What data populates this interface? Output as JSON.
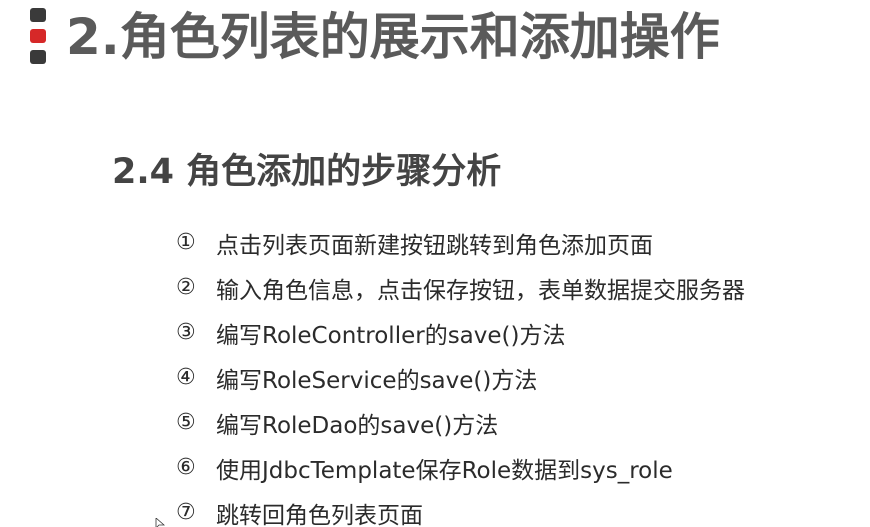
{
  "header": {
    "title": "2.角色列表的展示和添加操作"
  },
  "section": {
    "title": "2.4 角色添加的步骤分析"
  },
  "steps": [
    {
      "num": "①",
      "text": "点击列表页面新建按钮跳转到角色添加页面"
    },
    {
      "num": "②",
      "text": "输入角色信息，点击保存按钮，表单数据提交服务器"
    },
    {
      "num": "③",
      "text": "编写RoleController的save()方法"
    },
    {
      "num": "④",
      "text": "编写RoleService的save()方法"
    },
    {
      "num": "⑤",
      "text": "编写RoleDao的save()方法"
    },
    {
      "num": "⑥",
      "text": "使用JdbcTemplate保存Role数据到sys_role"
    },
    {
      "num": "⑦",
      "text": "跳转回角色列表页面"
    }
  ],
  "colors": {
    "marker_dark": "#3a3a3a",
    "marker_accent": "#d62828",
    "title": "#5a5a5a",
    "subtitle": "#444444",
    "body_text": "#2b2b2b"
  },
  "icons": {
    "marker": "slide-section-marker-icon",
    "cursor": "mouse-pointer-icon"
  }
}
